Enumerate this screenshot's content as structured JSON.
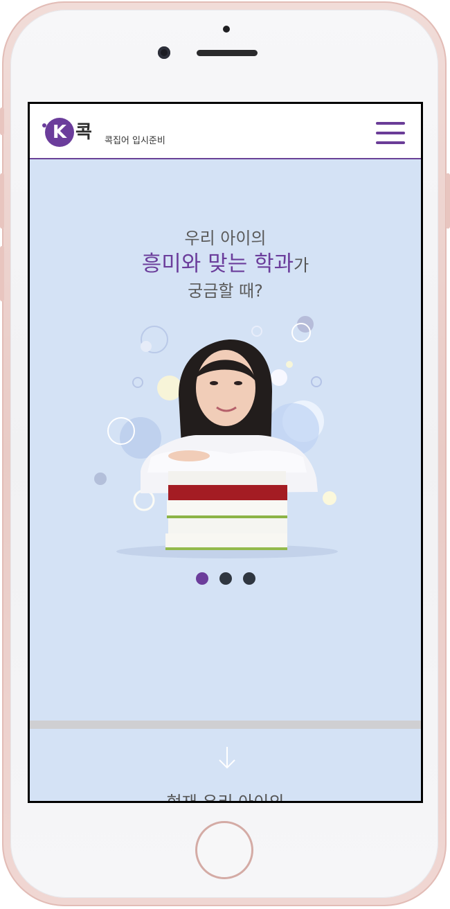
{
  "brand": {
    "logo_letter": "K",
    "logo_name": "콕",
    "tagline": "콕집어 입시준비",
    "accent_color": "#6b3d9b"
  },
  "header": {
    "menu_icon": "hamburger-menu-icon"
  },
  "hero": {
    "line1": "우리 아이의",
    "line2_accent": "흥미와 맞는 학과",
    "line2_suffix": "가",
    "line3": "궁금할 때?",
    "image": "student-with-books-illustration",
    "slides": 3,
    "active_slide": 1
  },
  "next_section": {
    "arrow_icon": "arrow-down-icon",
    "title": "현재 우리 아이의"
  },
  "colors": {
    "background": "#d4e2f5",
    "dot_inactive": "#2f3640"
  }
}
